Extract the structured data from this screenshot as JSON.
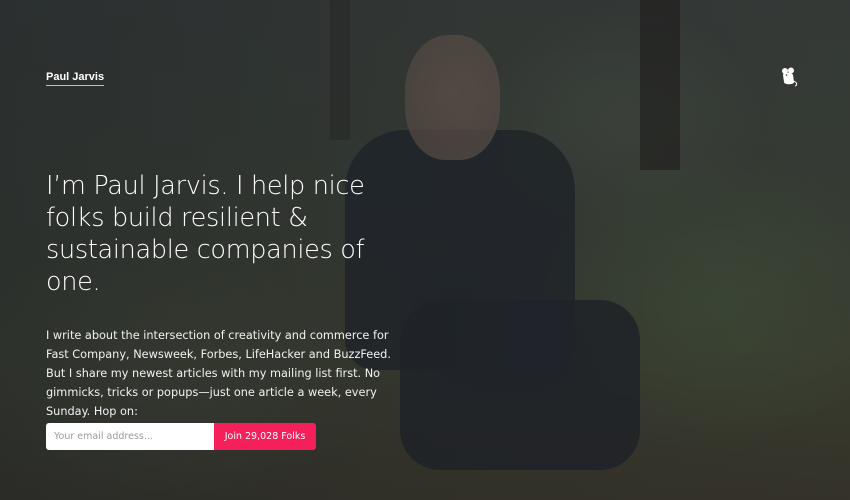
{
  "header": {
    "brand": "Paul Jarvis",
    "logo_icon": "mouse-icon"
  },
  "hero": {
    "headline": "I’m Paul Jarvis. I help nice folks build resilient & sustainable companies of one.",
    "intro": "I write about the intersection of creativity and commerce for Fast Company, Newsweek, Forbes, LifeHacker and BuzzFeed. But I share my newest articles with my mailing list first. No gimmicks, tricks or popups—just one article a week, every Sunday. Hop on:"
  },
  "signup": {
    "email_placeholder": "Your email address...",
    "email_value": "",
    "button_label": "Join 29,028 Folks"
  },
  "colors": {
    "accent": "#f5205a",
    "text": "#ffffff"
  }
}
